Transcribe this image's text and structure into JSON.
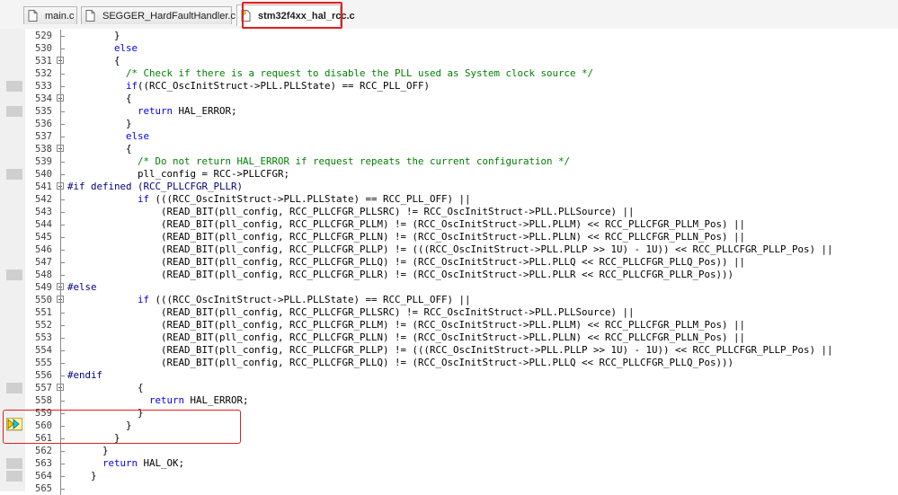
{
  "tabs": [
    {
      "label": "main.c",
      "active": false,
      "icon": "c-file-icon"
    },
    {
      "label": "SEGGER_HardFaultHandler.c",
      "active": false,
      "icon": "c-file-icon"
    },
    {
      "label": "stm32f4xx_hal_rcc.c",
      "active": true,
      "icon": "c-file-breakpoint-icon"
    }
  ],
  "colors": {
    "keyword": "#0000ff",
    "comment": "#008000",
    "preprocessor": "#000080",
    "annotation": "#e02020"
  },
  "editor": {
    "current_line": "558",
    "lines": [
      {
        "num": "529",
        "text": "        }"
      },
      {
        "num": "530",
        "text": "        else"
      },
      {
        "num": "531",
        "text": "        {"
      },
      {
        "num": "532",
        "text": "          /* Check if there is a request to disable the PLL used as System clock source */"
      },
      {
        "num": "533",
        "text": "          if((RCC_OscInitStruct->PLL.PLLState) == RCC_PLL_OFF)"
      },
      {
        "num": "534",
        "text": "          {"
      },
      {
        "num": "535",
        "text": "            return HAL_ERROR;"
      },
      {
        "num": "536",
        "text": "          }"
      },
      {
        "num": "537",
        "text": "          else"
      },
      {
        "num": "538",
        "text": "          {"
      },
      {
        "num": "539",
        "text": "            /* Do not return HAL_ERROR if request repeats the current configuration */"
      },
      {
        "num": "540",
        "text": "            pll_config = RCC->PLLCFGR;"
      },
      {
        "num": "541",
        "text": "#if defined (RCC_PLLCFGR_PLLR)"
      },
      {
        "num": "542",
        "text": "            if (((RCC_OscInitStruct->PLL.PLLState) == RCC_PLL_OFF) ||"
      },
      {
        "num": "543",
        "text": "                (READ_BIT(pll_config, RCC_PLLCFGR_PLLSRC) != RCC_OscInitStruct->PLL.PLLSource) ||"
      },
      {
        "num": "544",
        "text": "                (READ_BIT(pll_config, RCC_PLLCFGR_PLLM) != (RCC_OscInitStruct->PLL.PLLM) << RCC_PLLCFGR_PLLM_Pos) ||"
      },
      {
        "num": "545",
        "text": "                (READ_BIT(pll_config, RCC_PLLCFGR_PLLN) != (RCC_OscInitStruct->PLL.PLLN) << RCC_PLLCFGR_PLLN_Pos) ||"
      },
      {
        "num": "546",
        "text": "                (READ_BIT(pll_config, RCC_PLLCFGR_PLLP) != (((RCC_OscInitStruct->PLL.PLLP >> 1U) - 1U)) << RCC_PLLCFGR_PLLP_Pos) ||"
      },
      {
        "num": "547",
        "text": "                (READ_BIT(pll_config, RCC_PLLCFGR_PLLQ) != (RCC_OscInitStruct->PLL.PLLQ << RCC_PLLCFGR_PLLQ_Pos)) ||"
      },
      {
        "num": "548",
        "text": "                (READ_BIT(pll_config, RCC_PLLCFGR_PLLR) != (RCC_OscInitStruct->PLL.PLLR << RCC_PLLCFGR_PLLR_Pos)))"
      },
      {
        "num": "549",
        "text": "#else"
      },
      {
        "num": "550",
        "text": "            if (((RCC_OscInitStruct->PLL.PLLState) == RCC_PLL_OFF) ||"
      },
      {
        "num": "551",
        "text": "                (READ_BIT(pll_config, RCC_PLLCFGR_PLLSRC) != RCC_OscInitStruct->PLL.PLLSource) ||"
      },
      {
        "num": "552",
        "text": "                (READ_BIT(pll_config, RCC_PLLCFGR_PLLM) != (RCC_OscInitStruct->PLL.PLLM) << RCC_PLLCFGR_PLLM_Pos) ||"
      },
      {
        "num": "553",
        "text": "                (READ_BIT(pll_config, RCC_PLLCFGR_PLLN) != (RCC_OscInitStruct->PLL.PLLN) << RCC_PLLCFGR_PLLN_Pos) ||"
      },
      {
        "num": "554",
        "text": "                (READ_BIT(pll_config, RCC_PLLCFGR_PLLP) != (((RCC_OscInitStruct->PLL.PLLP >> 1U) - 1U)) << RCC_PLLCFGR_PLLP_Pos) ||"
      },
      {
        "num": "555",
        "text": "                (READ_BIT(pll_config, RCC_PLLCFGR_PLLQ) != (RCC_OscInitStruct->PLL.PLLQ << RCC_PLLCFGR_PLLQ_Pos)))"
      },
      {
        "num": "556",
        "text": "#endif"
      },
      {
        "num": "557",
        "text": "            {"
      },
      {
        "num": "558",
        "text": "              return HAL_ERROR;"
      },
      {
        "num": "559",
        "text": "            }"
      },
      {
        "num": "560",
        "text": "          }"
      },
      {
        "num": "561",
        "text": "        }"
      },
      {
        "num": "562",
        "text": "      }"
      },
      {
        "num": "563",
        "text": "      return HAL_OK;"
      },
      {
        "num": "564",
        "text": "    }"
      },
      {
        "num": "565",
        "text": ""
      }
    ]
  }
}
